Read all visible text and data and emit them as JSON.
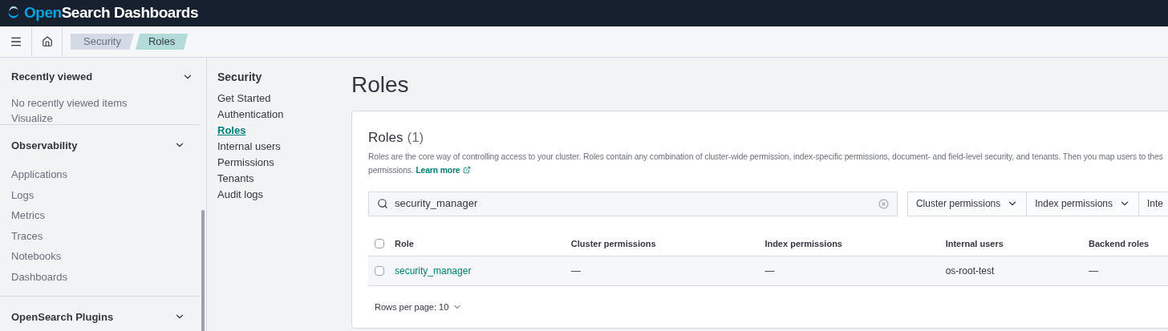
{
  "header": {
    "brand_open": "Open",
    "brand_rest": "Search Dashboards"
  },
  "breadcrumbs": [
    {
      "label": "Security",
      "selected": false
    },
    {
      "label": "Roles",
      "selected": true
    }
  ],
  "nav": {
    "recent": {
      "title": "Recently viewed",
      "empty": "No recently viewed items",
      "expanded": true
    },
    "partial_item": "Visualize",
    "groups": [
      {
        "title": "Observability",
        "expanded": true,
        "items": [
          "Applications",
          "Logs",
          "Metrics",
          "Traces",
          "Notebooks",
          "Dashboards"
        ]
      },
      {
        "title": "OpenSearch Plugins",
        "expanded": true
      }
    ]
  },
  "security_nav": {
    "title": "Security",
    "items": [
      {
        "label": "Get Started",
        "selected": false
      },
      {
        "label": "Authentication",
        "selected": false
      },
      {
        "label": "Roles",
        "selected": true
      },
      {
        "label": "Internal users",
        "selected": false
      },
      {
        "label": "Permissions",
        "selected": false
      },
      {
        "label": "Tenants",
        "selected": false
      },
      {
        "label": "Audit logs",
        "selected": false
      }
    ]
  },
  "page_title": "Roles",
  "panel": {
    "title": "Roles",
    "count": "(1)",
    "description_lines": [
      "Roles are the core way of controlling access to your cluster. Roles contain any combination of cluster-wide permission, index-specific permissions, document- and field-level security, and tenants. Then you map users to thes",
      "permissions."
    ],
    "learn_more": "Learn more",
    "search": {
      "value": "security_manager"
    },
    "all_checked": false,
    "filters": [
      {
        "label": "Cluster permissions",
        "kind": "dropdown"
      },
      {
        "label": "Index permissions",
        "kind": "dropdown"
      },
      {
        "label": "Inte",
        "kind": "cut"
      }
    ],
    "columns": [
      "Role",
      "Cluster permissions",
      "Index permissions",
      "Internal users",
      "Backend roles"
    ],
    "rows": [
      {
        "checked": false,
        "cells": [
          "security_manager",
          "—",
          "—",
          "os-root-test",
          "—"
        ]
      }
    ],
    "rows_per_page": "Rows per page: 10"
  }
}
